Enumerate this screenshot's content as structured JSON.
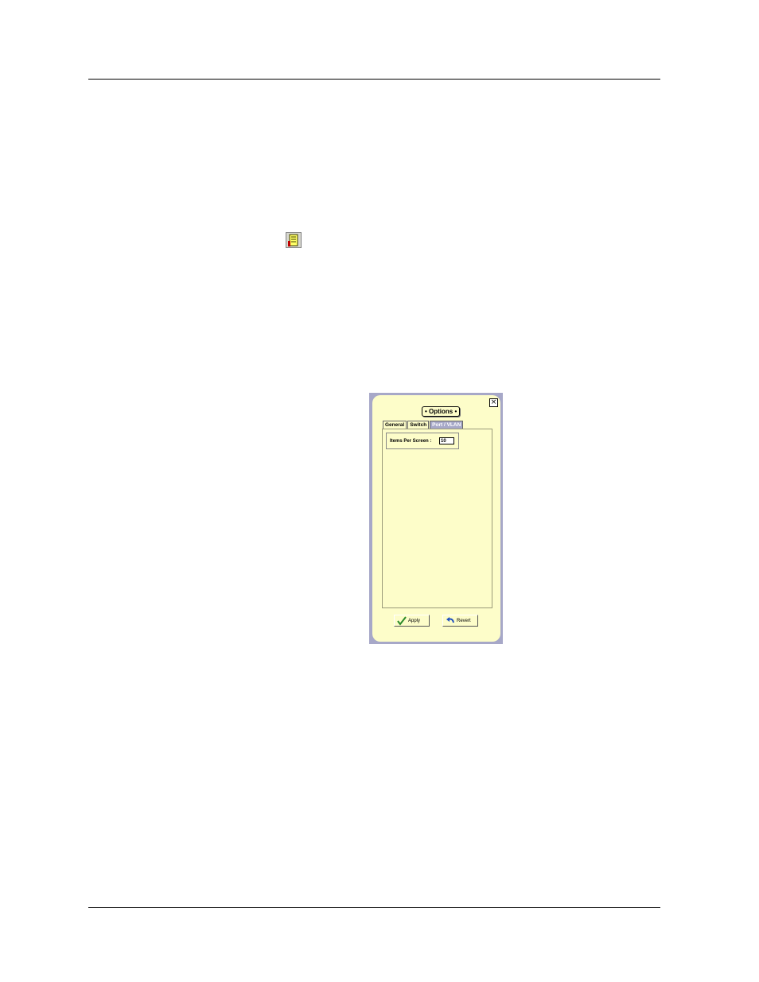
{
  "page": {
    "options_icon": "options-toolbar-icon"
  },
  "dialog": {
    "title": "• Options •",
    "close_icon": "close-icon",
    "tabs": [
      {
        "label": "General",
        "active": false
      },
      {
        "label": "Switch",
        "active": false
      },
      {
        "label": "Port / VLAN",
        "active": true
      }
    ],
    "field": {
      "label": "Items Per Screen :",
      "value": "10"
    },
    "buttons": {
      "apply_label": "Apply",
      "apply_icon": "checkmark-icon",
      "revert_label": "Revert",
      "revert_icon": "undo-arrow-icon"
    },
    "colors": {
      "background": "#fdfdc9",
      "frame": "#a7a8c8",
      "check": "#2a8a2a",
      "revert_arrow": "#2050c0"
    }
  }
}
